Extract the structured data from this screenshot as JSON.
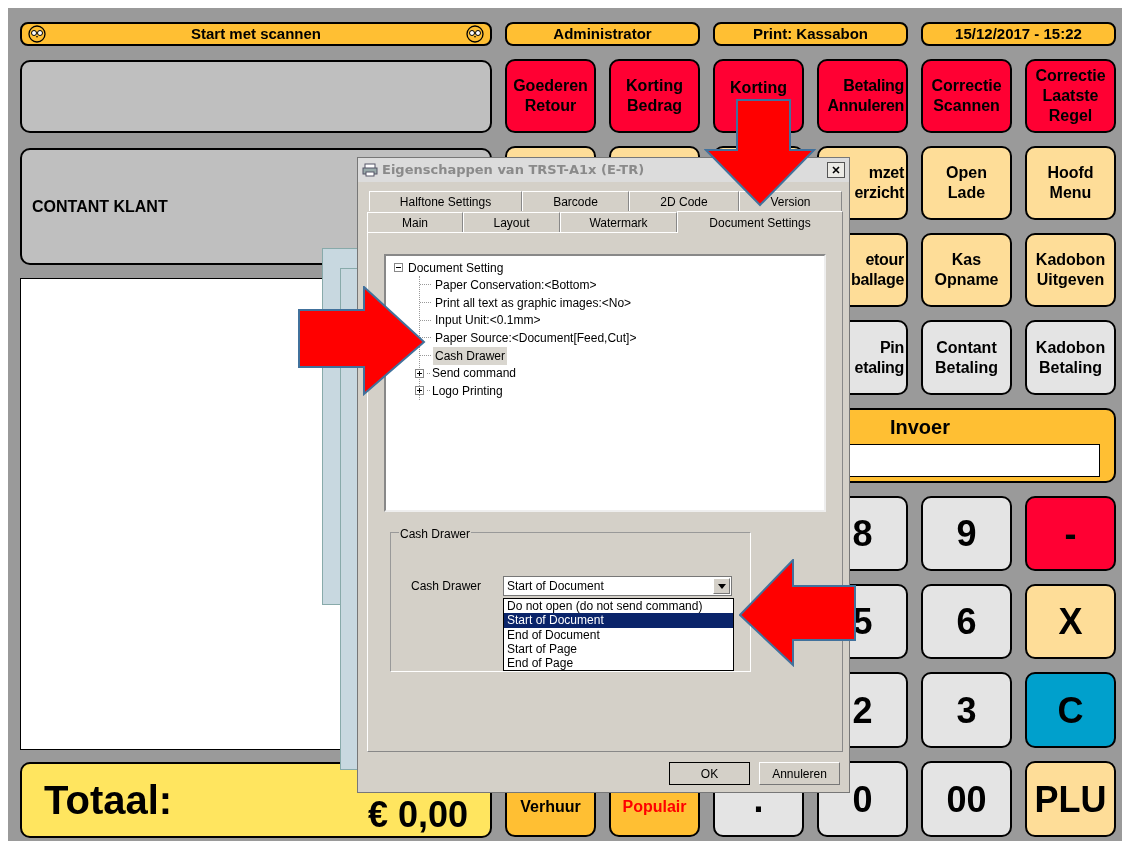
{
  "header": {
    "title": "Start met scannen",
    "user": "Administrator",
    "printer": "Print: Kassabon",
    "datetime": "15/12/2017 - 15:22"
  },
  "customer": "CONTANT KLANT",
  "total": {
    "label": "Totaal:",
    "amount": "€ 0,00"
  },
  "key_rows": [
    {
      "keys": [
        {
          "label": "Goederen\nRetour",
          "color": "#ff0033"
        },
        {
          "label": "Korting\nBedrag",
          "color": "#ff0033"
        },
        {
          "label": "Korting",
          "color": "#ff0033"
        },
        {
          "label": "Betaling\nAnnuleren",
          "color": "#ff0033"
        },
        {
          "label": "Correctie\nScannen",
          "color": "#ff0033"
        },
        {
          "label": "Correctie\nLaatste\nRegel",
          "color": "#ff0033"
        }
      ]
    },
    {
      "keys": [
        {
          "color": "#fedd98"
        },
        {
          "color": "#fedd98"
        },
        {
          "color": "#fedd98"
        },
        {
          "label": "mzet\nerzicht",
          "color": "#fedd98"
        },
        {
          "label": "Open\nLade",
          "color": "#fedd98"
        },
        {
          "label": "Hoofd\nMenu",
          "color": "#fedd98"
        }
      ]
    },
    {
      "keys": [
        {
          "label": "etour\nballage",
          "color": "#fedd98"
        },
        {
          "label": "Kas\nOpname",
          "color": "#fedd98"
        },
        {
          "label": "Kadobon\nUitgeven",
          "color": "#fedd98"
        }
      ]
    },
    {
      "keys": [
        {
          "label": "Pin\netaling",
          "color": "#e4e4e4"
        },
        {
          "label": "Contant\nBetaling",
          "color": "#e4e4e4"
        },
        {
          "label": "Kadobon\nBetaling",
          "color": "#e4e4e4"
        }
      ]
    }
  ],
  "input_panel": {
    "label": "Invoer"
  },
  "keypad_rows": [
    {
      "keys": [
        {
          "label": "8",
          "color": "#e4e4e4"
        },
        {
          "label": "9",
          "color": "#e4e4e4"
        },
        {
          "label": "-",
          "color": "#ff0033"
        }
      ]
    },
    {
      "keys": [
        {
          "label": "5",
          "color": "#e4e4e4"
        },
        {
          "label": "6",
          "color": "#e4e4e4"
        },
        {
          "label": "X",
          "color": "#fedd98"
        }
      ]
    },
    {
      "keys": [
        {
          "label": "2",
          "color": "#e4e4e4"
        },
        {
          "label": "3",
          "color": "#e4e4e4"
        },
        {
          "label": "C",
          "color": "#00a0cc"
        }
      ]
    },
    {
      "keys": [
        {
          "label": "Verhuur",
          "color": "#ffbf33"
        },
        {
          "label": "Populair",
          "color": "#ffbf33",
          "kind": "highlighted"
        },
        {
          "label": ".",
          "color": "#e4e4e4"
        },
        {
          "label": "0",
          "color": "#e4e4e4"
        },
        {
          "label": "00",
          "color": "#e4e4e4"
        },
        {
          "label": "PLU",
          "color": "#fedd98"
        }
      ]
    }
  ],
  "dialog": {
    "title": "Eigenschappen van TRST-A1x (E-TR)",
    "tab_rows": [
      [
        {
          "label": "Halftone Settings",
          "selected": false
        },
        {
          "label": "Barcode",
          "selected": false
        },
        {
          "label": "2D Code",
          "selected": false
        },
        {
          "label": "Version",
          "selected": false
        }
      ],
      [
        {
          "label": "Main",
          "selected": false
        },
        {
          "label": "Layout",
          "selected": false
        },
        {
          "label": "Watermark",
          "selected": false
        },
        {
          "label": "Document Settings",
          "selected": true
        }
      ]
    ],
    "tree": {
      "label": "Document Setting",
      "expanded": true,
      "children": [
        {
          "label": "Paper Conservation:<Bottom>",
          "selected": false
        },
        {
          "label": "Print all text as graphic images:<No>",
          "selected": false
        },
        {
          "label": "Input Unit:<0.1mm>",
          "selected": false
        },
        {
          "label": "Paper Source:<Document[Feed,Cut]>",
          "selected": false
        },
        {
          "label": "Cash Drawer",
          "selected": true
        },
        {
          "label": "Send command",
          "selected": false,
          "expanded": false
        },
        {
          "label": "Logo Printing",
          "selected": false,
          "expanded": false
        }
      ]
    },
    "group": {
      "title": "Cash Drawer",
      "field_label": "Cash Drawer",
      "value": "Start of Document",
      "options": [
        {
          "label": "Do not open (do not send command)",
          "selected": false
        },
        {
          "label": "Start of Document",
          "selected": true
        },
        {
          "label": "End of Document",
          "selected": false
        },
        {
          "label": "Start of Page",
          "selected": false
        },
        {
          "label": "End of Page",
          "selected": false
        }
      ]
    },
    "buttons": [
      "OK",
      "Annuleren"
    ]
  }
}
